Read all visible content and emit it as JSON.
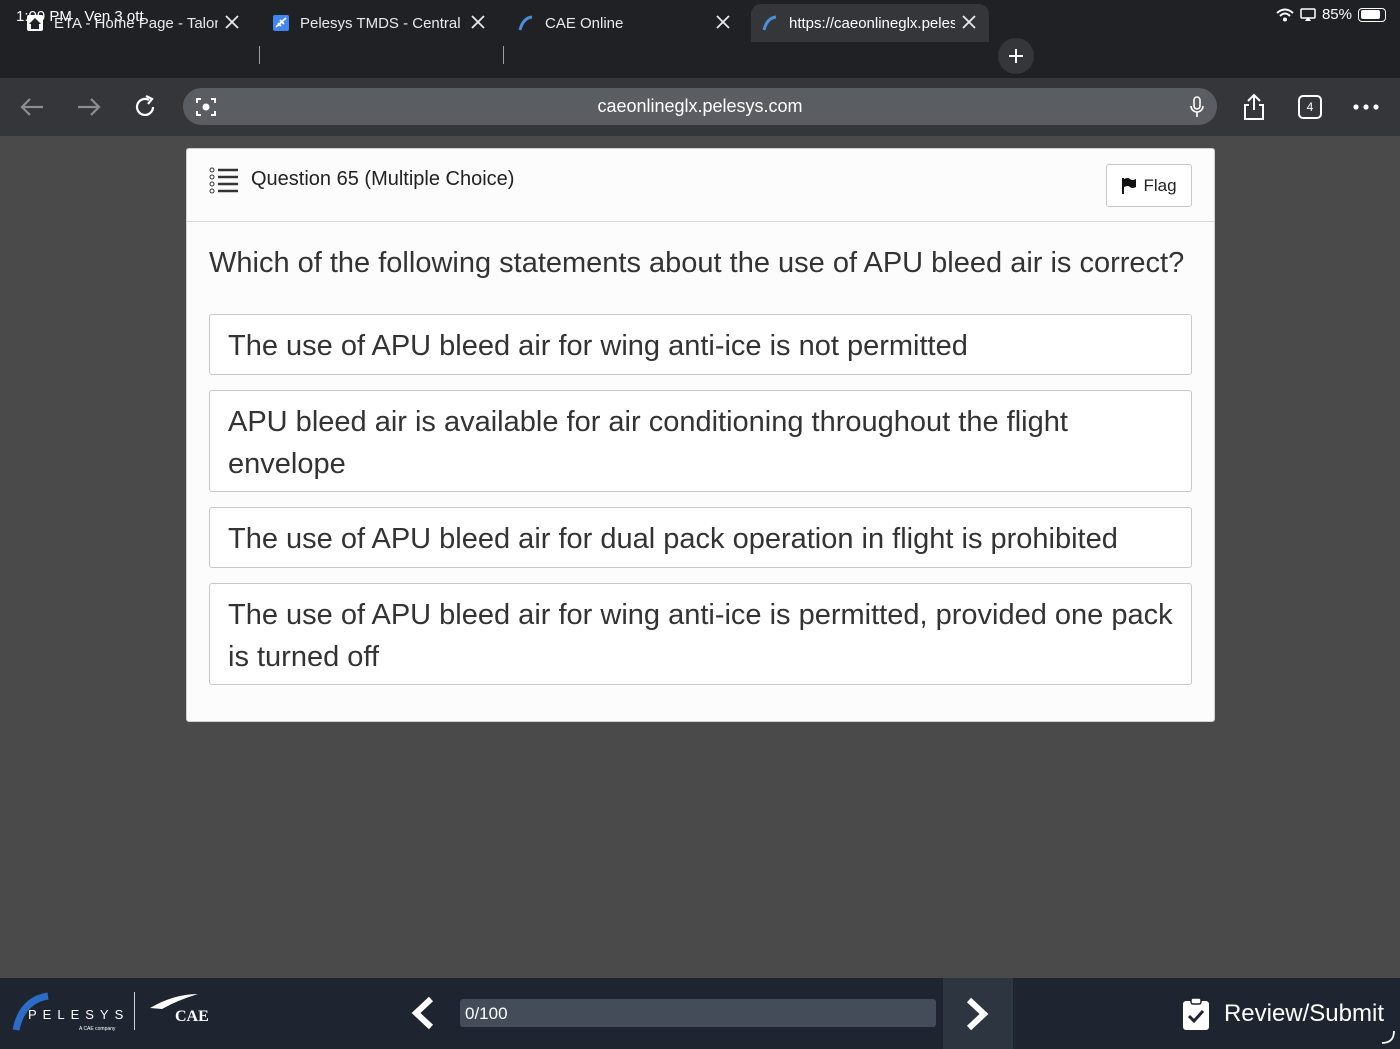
{
  "status_bar": {
    "time": "1:09 PM",
    "date": "Ven 3 ott",
    "battery": "85%",
    "battery_level": 0.85
  },
  "tabs": [
    {
      "title": "ETA - Home Page - Talon",
      "icon": "home-favicon"
    },
    {
      "title": "Pelesys TMDS - Central",
      "icon": "plane-favicon"
    },
    {
      "title": "CAE Online",
      "icon": "pelesys-favicon"
    },
    {
      "title": "https://caeonlineglx.pelesys.com",
      "icon": "pelesys-favicon",
      "active": true
    }
  ],
  "toolbar": {
    "url": "caeonlineglx.pelesys.com",
    "tab_count": "4"
  },
  "question": {
    "header": "Question 65 (Multiple Choice)",
    "flag_label": "Flag",
    "text": "Which of the following statements about the use of APU bleed air is correct?",
    "options": [
      "The use of APU bleed air for wing anti-ice is not permitted",
      "APU bleed air is available for air conditioning throughout the flight envelope",
      "The use of APU bleed air for dual pack operation in flight is prohibited",
      "The use of APU bleed air for wing anti-ice is permitted, provided one pack is turned off"
    ]
  },
  "footer": {
    "logo_text": "PELESYS",
    "logo_sub": "A CAE company",
    "cae_text": "CAE",
    "progress_label": "0/100",
    "progress_value": 0,
    "review_label": "Review/Submit"
  },
  "colors": {
    "chrome_dark": "#202124",
    "toolbar": "#35363a",
    "page_bg": "#4a4a4a",
    "footer": "#1e2430",
    "accent": "#1a73e8"
  }
}
